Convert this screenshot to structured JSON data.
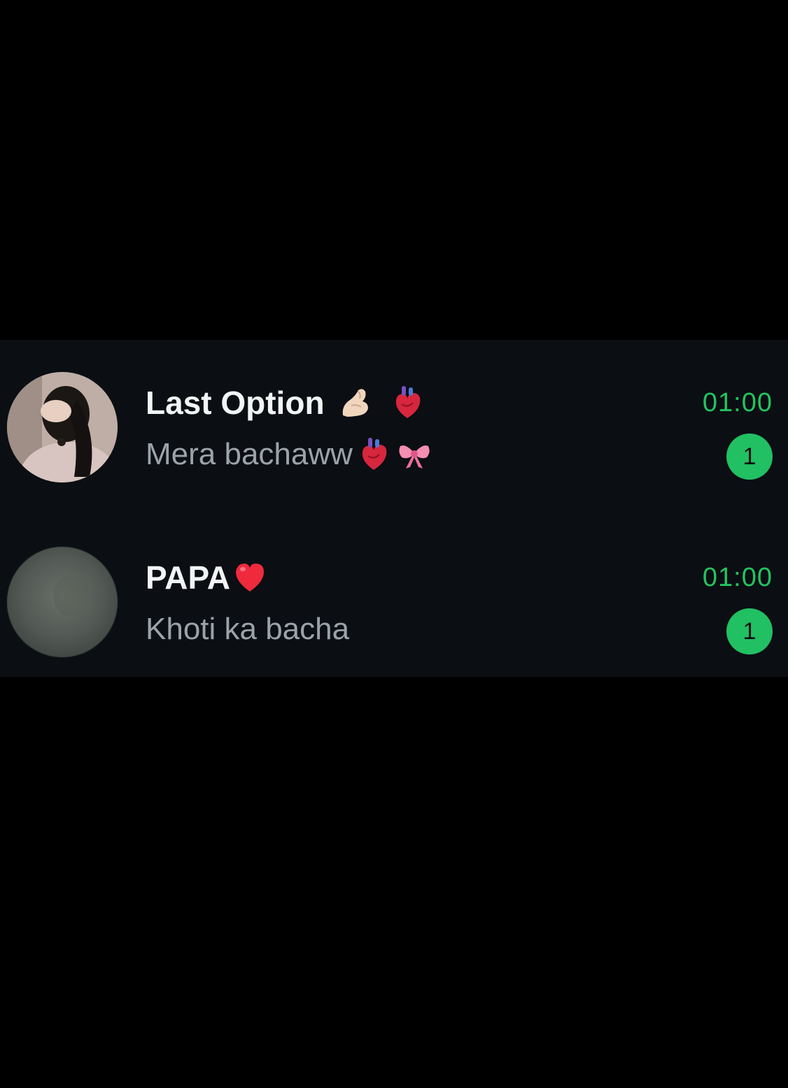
{
  "chats": [
    {
      "name": "Last Option",
      "name_emojis": [
        "pinched-fingers-icon",
        "anatomical-heart-icon"
      ],
      "preview": "Mera bachaww",
      "preview_emojis": [
        "anatomical-heart-icon",
        "ribbon-bow-icon"
      ],
      "time": "01:00",
      "unread": "1",
      "avatar": "photo-avatar"
    },
    {
      "name": "PAPA",
      "name_emojis": [
        "red-heart-icon"
      ],
      "preview": "Khoti ka bacha",
      "preview_emojis": [],
      "time": "01:00",
      "unread": "1",
      "avatar": "blurred-avatar"
    }
  ],
  "colors": {
    "background": "#000000",
    "list_background": "#0b0e13",
    "name_text": "#f2f4f5",
    "preview_text": "#9aa3a8",
    "accent_green": "#22c55e",
    "badge_green": "#21c063"
  }
}
